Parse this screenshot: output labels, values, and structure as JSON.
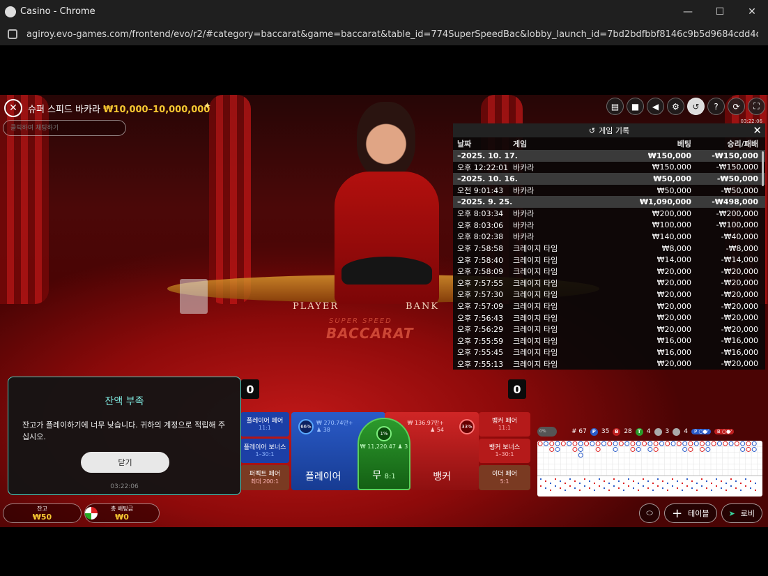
{
  "window": {
    "title": "Casino - Chrome",
    "url": "agiroy.evo-games.com/frontend/evo/r2/#category=baccarat&game=baccarat&table_id=774SuperSpeedBac&lobby_launch_id=7bd2bdfbbf8146c9b5d9684cdd4de..."
  },
  "header": {
    "table_name": "슈퍼 스피드 바카라",
    "limit": "₩10,000–10,000,000",
    "chat_placeholder": "클릭하여 채팅하기",
    "time": "03:22:06"
  },
  "table": {
    "player_label": "PLAYER",
    "banker_label": "BANK",
    "logo_top": "SUPER SPEED",
    "logo": "BACCARAT",
    "player_score": "0",
    "banker_score": "0"
  },
  "history": {
    "title": "게임 기록",
    "columns": [
      "날짜",
      "게임",
      "베팅",
      "승리/패배"
    ],
    "rows": [
      {
        "date": "–2025. 10. 17.",
        "game": "",
        "bet": "₩150,000",
        "result": "-₩150,000",
        "is_date": true
      },
      {
        "date": "오후 12:22:01",
        "game": "바카라",
        "bet": "₩150,000",
        "result": "-₩150,000"
      },
      {
        "date": "–2025. 10. 16.",
        "game": "",
        "bet": "₩50,000",
        "result": "-₩50,000",
        "is_date": true
      },
      {
        "date": "오전 9:01:43",
        "game": "바카라",
        "bet": "₩50,000",
        "result": "-₩50,000"
      },
      {
        "date": "–2025. 9. 25.",
        "game": "",
        "bet": "₩1,090,000",
        "result": "-₩498,000",
        "is_date": true
      },
      {
        "date": "오후 8:03:34",
        "game": "바카라",
        "bet": "₩200,000",
        "result": "-₩200,000"
      },
      {
        "date": "오후 8:03:06",
        "game": "바카라",
        "bet": "₩100,000",
        "result": "-₩100,000"
      },
      {
        "date": "오후 8:02:38",
        "game": "바카라",
        "bet": "₩140,000",
        "result": "-₩40,000"
      },
      {
        "date": "오후 7:58:58",
        "game": "크레이지 타임",
        "bet": "₩8,000",
        "result": "-₩8,000"
      },
      {
        "date": "오후 7:58:40",
        "game": "크레이지 타임",
        "bet": "₩14,000",
        "result": "-₩14,000"
      },
      {
        "date": "오후 7:58:09",
        "game": "크레이지 타임",
        "bet": "₩20,000",
        "result": "-₩20,000"
      },
      {
        "date": "오후 7:57:55",
        "game": "크레이지 타임",
        "bet": "₩20,000",
        "result": "-₩20,000"
      },
      {
        "date": "오후 7:57:30",
        "game": "크레이지 타임",
        "bet": "₩20,000",
        "result": "-₩20,000"
      },
      {
        "date": "오후 7:57:09",
        "game": "크레이지 타임",
        "bet": "₩20,000",
        "result": "-₩20,000"
      },
      {
        "date": "오후 7:56:43",
        "game": "크레이지 타임",
        "bet": "₩20,000",
        "result": "-₩20,000"
      },
      {
        "date": "오후 7:56:29",
        "game": "크레이지 타임",
        "bet": "₩20,000",
        "result": "-₩20,000"
      },
      {
        "date": "오후 7:55:59",
        "game": "크레이지 타임",
        "bet": "₩16,000",
        "result": "-₩16,000"
      },
      {
        "date": "오후 7:55:45",
        "game": "크레이지 타임",
        "bet": "₩16,000",
        "result": "-₩16,000"
      },
      {
        "date": "오후 7:55:13",
        "game": "크레이지 타임",
        "bet": "₩20,000",
        "result": "-₩20,000"
      }
    ]
  },
  "bets": {
    "player_pair": {
      "label": "플레이어 페어",
      "odds": "11:1"
    },
    "player_bonus": {
      "label": "플레이어 보너스",
      "odds": "1–30:1"
    },
    "perfect_pair": {
      "label": "퍼펙트 페어",
      "odds": "최대 200:1"
    },
    "player": {
      "label": "플레이어",
      "amount": "₩ 270.74만+",
      "count": "38",
      "pct": "66%"
    },
    "tie": {
      "label": "무",
      "odds": "8:1",
      "amount": "₩ 11,220.47",
      "count": "3",
      "pct": "1%"
    },
    "banker": {
      "label": "뱅커",
      "amount": "₩ 136.97만+",
      "count": "54",
      "pct": "33%"
    },
    "banker_pair": {
      "label": "뱅커 페어",
      "odds": "11:1"
    },
    "banker_bonus": {
      "label": "뱅커 보너스",
      "odds": "1–30:1"
    },
    "either_pair": {
      "label": "이더 페어",
      "odds": "5:1"
    }
  },
  "roads": {
    "toggle": "0%",
    "total": "# 67",
    "p": "P",
    "p_count": "35",
    "b": "B",
    "b_count": "28",
    "t": "T",
    "t_count": "4",
    "pp_count": "3",
    "bp_count": "4"
  },
  "notice": {
    "title": "잔액 부족",
    "message": "잔고가 플레이하기에 너무 낮습니다. 귀하의 계정으로 적립해 주십시오.",
    "close_label": "닫기",
    "time": "03:22:06"
  },
  "footer": {
    "balance_label": "잔고",
    "balance": "₩50",
    "total_bet_label": "총 배팅금",
    "total_bet": "₩0",
    "table_label": "테이블",
    "lobby_label": "로비"
  },
  "colors": {
    "accent_gold": "#f6c731",
    "player_blue": "#1c3fa6",
    "banker_red": "#b51a1a",
    "tie_green": "#2c9a2c",
    "notice_border": "#4fd0c0"
  }
}
